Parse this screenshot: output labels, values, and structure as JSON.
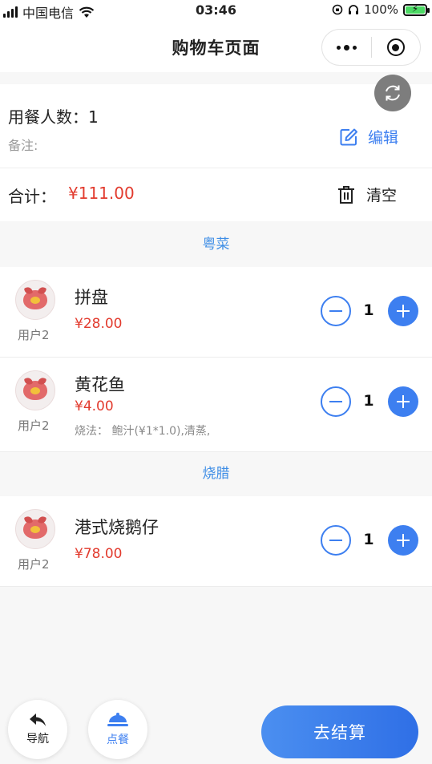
{
  "status_bar": {
    "carrier": "中国电信",
    "time": "03:46",
    "battery": "100%"
  },
  "nav": {
    "title": "购物车页面"
  },
  "cart_info": {
    "diners_label": "用餐人数：",
    "diners_count": "1",
    "remark_label": "备注:",
    "edit_label": "编辑"
  },
  "summary": {
    "total_label": "合计：",
    "total_amount": "¥111.00",
    "clear_label": "清空"
  },
  "categories": [
    {
      "name": "粤菜",
      "items": [
        {
          "user": "用户2",
          "name": "拼盘",
          "price": "¥28.00",
          "qty": "1",
          "note": ""
        },
        {
          "user": "用户2",
          "name": "黄花鱼",
          "price": "¥4.00",
          "qty": "1",
          "note": "烧法： 鲍汁(¥1*1.0),清蒸,"
        }
      ]
    },
    {
      "name": "烧腊",
      "items": [
        {
          "user": "用户2",
          "name": "港式烧鹅仔",
          "price": "¥78.00",
          "qty": "1",
          "note": ""
        }
      ]
    }
  ],
  "bottom": {
    "nav_label": "导航",
    "order_label": "点餐",
    "checkout_label": "去结算"
  },
  "colors": {
    "accent": "#3d7ff0",
    "price": "#e23b2e",
    "category": "#3f8ee6"
  }
}
